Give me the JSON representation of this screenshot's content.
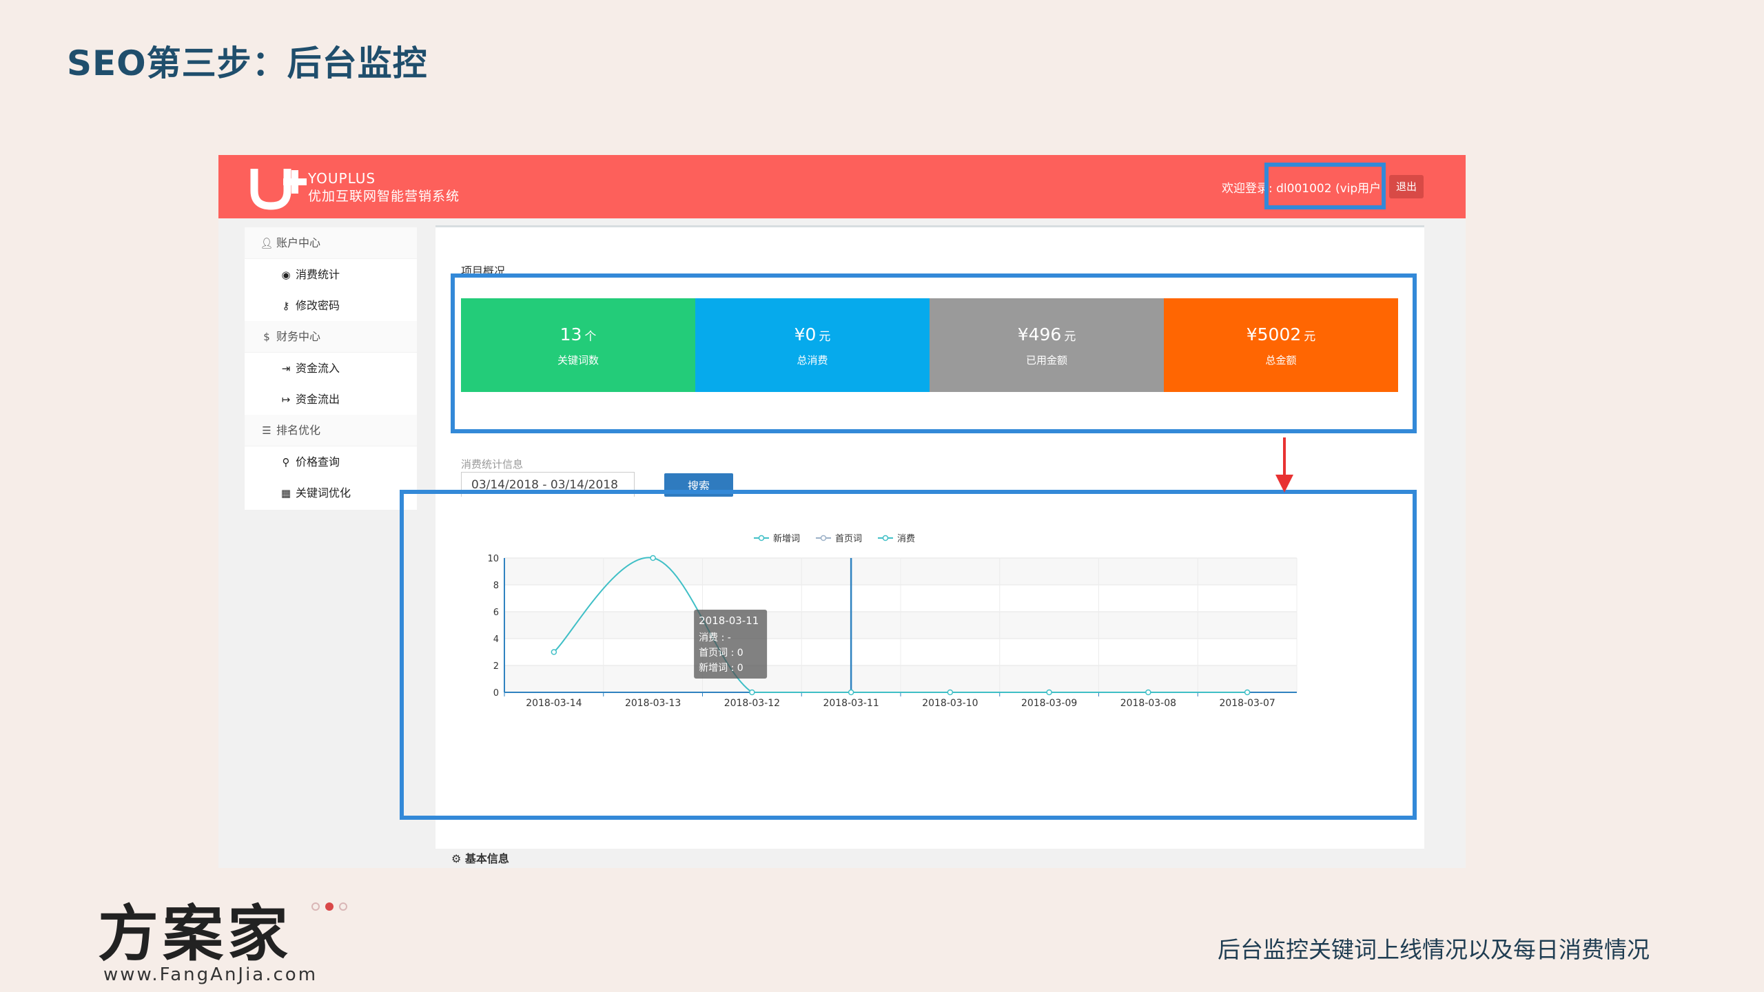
{
  "slide": {
    "title": "SEO第三步：后台监控",
    "caption": "后台监控关键词上线情况以及每日消费情况"
  },
  "brand": {
    "logo_text": "方案家",
    "url": "www.FangAnJia.com"
  },
  "app": {
    "logo_en": "YOUPLUS",
    "logo_cn": "优加互联网智能营销系统",
    "welcome_prefix": "欢迎登录:",
    "username": "dl001002 (vip用户)",
    "logout_label": "退出",
    "accent_color": "#fd605b"
  },
  "sidebar": {
    "groups": [
      {
        "label": "账户中心",
        "icon": "user-icon",
        "items": [
          {
            "label": "消费统计",
            "icon": "user-circle-icon"
          },
          {
            "label": "修改密码",
            "icon": "key-icon"
          }
        ]
      },
      {
        "label": "财务中心",
        "icon": "dollar-icon",
        "items": [
          {
            "label": "资金流入",
            "icon": "sign-in-icon"
          },
          {
            "label": "资金流出",
            "icon": "sign-out-icon"
          }
        ]
      },
      {
        "label": "排名优化",
        "icon": "list-icon",
        "items": [
          {
            "label": "价格查询",
            "icon": "search-icon"
          },
          {
            "label": "关键词优化",
            "icon": "table-icon"
          }
        ]
      }
    ]
  },
  "overview": {
    "section_label": "项目概况",
    "cards": [
      {
        "value": "13",
        "unit": "个",
        "label": "关键词数",
        "color": "#23cc79"
      },
      {
        "value": "¥0",
        "unit": "元",
        "label": "总消费",
        "color": "#06aaec"
      },
      {
        "value": "¥496",
        "unit": "元",
        "label": "已用金额",
        "color": "#9a9a9a"
      },
      {
        "value": "¥5002",
        "unit": "元",
        "label": "总金额",
        "color": "#ff6602"
      }
    ]
  },
  "filter": {
    "label": "消费统计信息",
    "date_range": "03/14/2018 - 03/14/2018",
    "search_label": "搜索"
  },
  "chart_data": {
    "type": "line",
    "categories": [
      "2018-03-14",
      "2018-03-13",
      "2018-03-12",
      "2018-03-11",
      "2018-03-10",
      "2018-03-09",
      "2018-03-08",
      "2018-03-07"
    ],
    "series": [
      {
        "name": "新增词",
        "values": [
          3,
          10,
          0,
          0,
          0,
          0,
          0,
          0
        ],
        "color": "#3fbfc6"
      },
      {
        "name": "首页词",
        "values": [
          0,
          0,
          0,
          0,
          0,
          0,
          0,
          0
        ],
        "color": "#9bb0c7"
      },
      {
        "name": "消费",
        "values": [
          null,
          null,
          null,
          null,
          null,
          null,
          null,
          null
        ],
        "color": "#3fbfc6"
      }
    ],
    "ylim": [
      0,
      10
    ],
    "yticks": [
      0,
      2,
      4,
      6,
      8,
      10
    ],
    "grid": true,
    "legend": "top-center",
    "tooltip": {
      "title": "2018-03-11",
      "lines": [
        "消费 : -",
        "首页词 : 0",
        "新增词 : 0"
      ]
    }
  },
  "basic_info_label": "基本信息",
  "highlight_color": "#3389d8"
}
